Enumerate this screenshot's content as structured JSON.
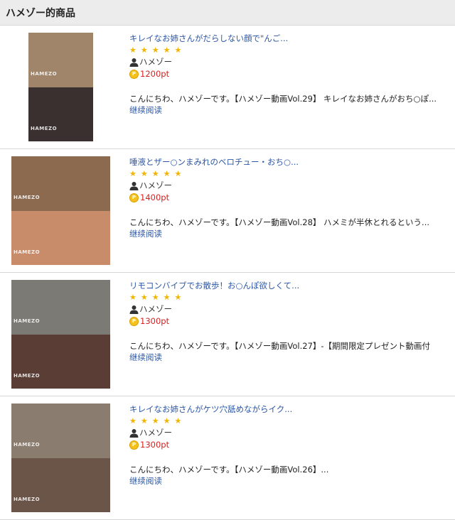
{
  "header": {
    "title": "ハメゾー的商品"
  },
  "items": [
    {
      "title": "キレイなお姉さんがだらしない顔で\"んご...",
      "stars": "★★★★★",
      "author": "ハメゾー",
      "price": "1200pt",
      "desc": "こんにちわ、ハメゾーです。【ハメゾー動画Vol.29】 キレイなお姉さんがおち○ぽ...",
      "more": "继续阅读",
      "thumb": {
        "top": "#a0856a",
        "bottom": "#3b3030",
        "watermark": "HAMEZO"
      }
    },
    {
      "title": "唾液とザー○ンまみれのベロチュー・おち○...",
      "stars": "★★★★★",
      "author": "ハメゾー",
      "price": "1400pt",
      "desc": "こんにちわ、ハメゾーです。【ハメゾー動画Vol.28】 ハメミが半休とれるという...",
      "more": "继续阅读",
      "thumb": {
        "top": "#8b6a50",
        "bottom": "#c98c6a",
        "watermark": "HAMEZO"
      }
    },
    {
      "title": "リモコンバイブでお散歩！お○んぽ欲しくて...",
      "stars": "★★★★★",
      "author": "ハメゾー",
      "price": "1300pt",
      "desc": "こんにちわ、ハメゾーです。【ハメゾー動画Vol.27】-【期間限定プレゼント動画付",
      "more": "继续阅读",
      "thumb": {
        "top": "#7c7a74",
        "bottom": "#5a3e35",
        "watermark": "HAMEZO"
      }
    },
    {
      "title": "キレイなお姉さんがケツ穴舐めながらイク...",
      "stars": "★★★★★",
      "author": "ハメゾー",
      "price": "1300pt",
      "desc": "こんにちわ、ハメゾーです。【ハメゾー動画Vol.26】...",
      "more": "继续阅读",
      "thumb": {
        "top": "#8a7c6e",
        "bottom": "#6b5448",
        "watermark": "HAMEZO"
      }
    }
  ]
}
